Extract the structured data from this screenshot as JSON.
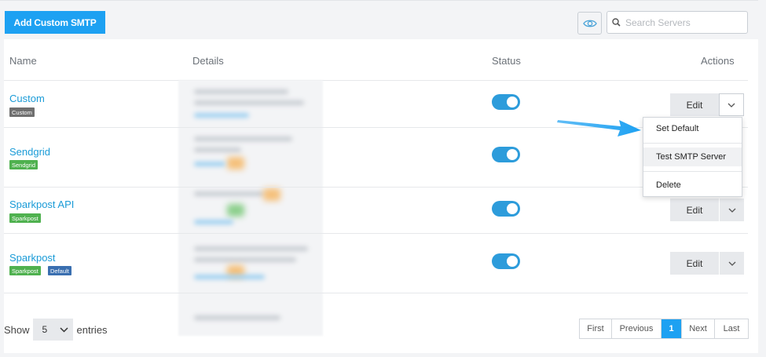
{
  "toolbar": {
    "add_label": "Add Custom SMTP",
    "search_placeholder": "Search Servers",
    "eye_icon": "eye-icon",
    "search_icon": "search-icon"
  },
  "table": {
    "headers": {
      "name": "Name",
      "details": "Details",
      "status": "Status",
      "actions": "Actions"
    },
    "rows": [
      {
        "name": "Custom",
        "tags": [
          "Custom"
        ],
        "status_enabled": true,
        "edit_label": "Edit"
      },
      {
        "name": "Sendgrid",
        "tags": [
          "Sendgrid"
        ],
        "status_enabled": true,
        "edit_label": "Edit"
      },
      {
        "name": "Sparkpost API",
        "tags": [
          "Sparkpost"
        ],
        "status_enabled": true,
        "edit_label": "Edit"
      },
      {
        "name": "Sparkpost",
        "tags": [
          "Sparkpost",
          "Default"
        ],
        "status_enabled": true,
        "edit_label": "Edit"
      }
    ]
  },
  "dropdown": {
    "items": [
      "Set Default",
      "Test SMTP Server",
      "Delete"
    ],
    "highlighted_item": "Test SMTP Server"
  },
  "footer": {
    "show_label": "Show",
    "entries_value": "5",
    "entries_label": "entries",
    "pager": [
      "First",
      "Previous",
      "1",
      "Next",
      "Last"
    ],
    "current_page": "1"
  },
  "colors": {
    "accent": "#1da1f2",
    "link": "#1a9bd7",
    "toggle_on": "#2d9cdb",
    "tag_grey": "#6f6f6f",
    "tag_green": "#4fb14f",
    "tag_blue": "#3a6fb0"
  }
}
